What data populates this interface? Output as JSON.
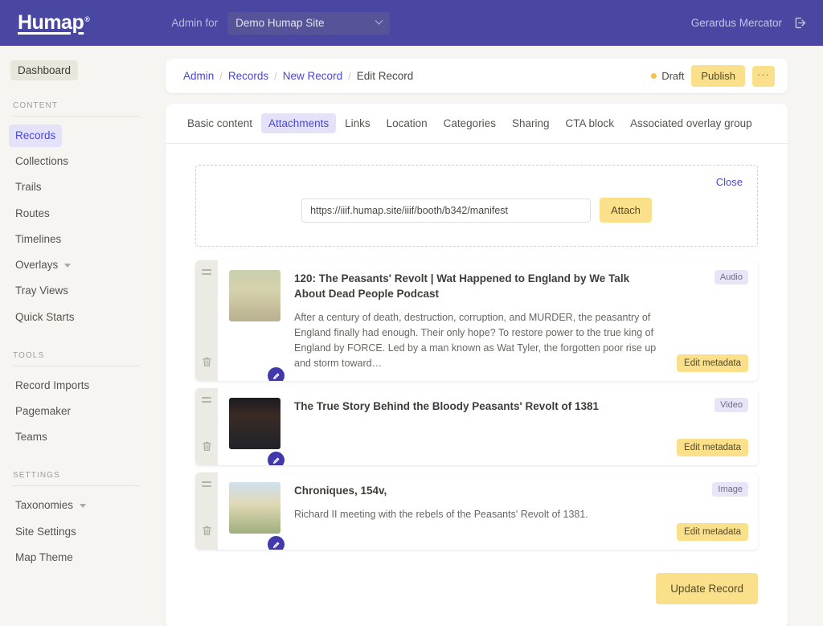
{
  "topbar": {
    "logo": "Humap",
    "logo_mark": "®",
    "admin_for_label": "Admin for",
    "site_name": "Demo Humap Site",
    "user_name": "Gerardus Mercator",
    "logout_icon": "logout-icon",
    "chevron_icon": "chevron-down-icon"
  },
  "sidebar": {
    "dashboard_label": "Dashboard",
    "groups": [
      {
        "label": "CONTENT",
        "items": [
          {
            "label": "Records",
            "active": true,
            "caret": false
          },
          {
            "label": "Collections",
            "active": false,
            "caret": false
          },
          {
            "label": "Trails",
            "active": false,
            "caret": false
          },
          {
            "label": "Routes",
            "active": false,
            "caret": false
          },
          {
            "label": "Timelines",
            "active": false,
            "caret": false
          },
          {
            "label": "Overlays",
            "active": false,
            "caret": true
          },
          {
            "label": "Tray Views",
            "active": false,
            "caret": false
          },
          {
            "label": "Quick Starts",
            "active": false,
            "caret": false
          }
        ]
      },
      {
        "label": "TOOLS",
        "items": [
          {
            "label": "Record Imports",
            "active": false,
            "caret": false
          },
          {
            "label": "Pagemaker",
            "active": false,
            "caret": false
          },
          {
            "label": "Teams",
            "active": false,
            "caret": false
          }
        ]
      },
      {
        "label": "SETTINGS",
        "items": [
          {
            "label": "Taxonomies",
            "active": false,
            "caret": true
          },
          {
            "label": "Site Settings",
            "active": false,
            "caret": false
          },
          {
            "label": "Map Theme",
            "active": false,
            "caret": false
          }
        ]
      }
    ]
  },
  "breadcrumb": {
    "items": [
      {
        "label": "Admin",
        "current": false
      },
      {
        "label": "Records",
        "current": false
      },
      {
        "label": "New Record",
        "current": false
      },
      {
        "label": "Edit Record",
        "current": true
      }
    ],
    "separator": "/",
    "status_label": "Draft",
    "status_color": "#f2c14e",
    "publish_label": "Publish",
    "more_label": "···"
  },
  "tabs": [
    {
      "label": "Basic content",
      "active": false
    },
    {
      "label": "Attachments",
      "active": true
    },
    {
      "label": "Links",
      "active": false
    },
    {
      "label": "Location",
      "active": false
    },
    {
      "label": "Categories",
      "active": false
    },
    {
      "label": "Sharing",
      "active": false
    },
    {
      "label": "CTA block",
      "active": false
    },
    {
      "label": "Associated overlay group",
      "active": false
    }
  ],
  "dropzone": {
    "close_label": "Close",
    "url_value": "https://iiif.humap.site/iiif/booth/b342/manifest",
    "url_placeholder": "https://",
    "attach_label": "Attach"
  },
  "attachments": {
    "edit_metadata_label": "Edit metadata",
    "drag_icon": "drag-handle-icon",
    "delete_icon": "trash-icon",
    "edit_thumb_icon": "pencil-icon",
    "items": [
      {
        "title": "120: The Peasants' Revolt | Wat Happened to England by We Talk About Dead People Podcast",
        "description": "After a century of death, destruction, corruption, and MURDER, the peasantry of England finally had enough. Their only hope? To restore power to the true king of England by FORCE. Led by a man known as Wat Tyler, the forgotten poor rise up and storm toward…",
        "type": "Audio",
        "thumb": "medieval-battle-manuscript"
      },
      {
        "title": "The True Story Behind the Bloody Peasants' Revolt of 1381",
        "description": "",
        "type": "Video",
        "thumb": "video-thumbnail-peasant-uprising"
      },
      {
        "title": "Chroniques, 154v,",
        "description": "Richard II meeting with the rebels of the Peasants' Revolt of 1381.",
        "type": "Image",
        "thumb": "chroniques-illumination"
      }
    ]
  },
  "footer": {
    "update_label": "Update Record"
  },
  "colors": {
    "brand_purple": "#4a47a3",
    "accent_yellow": "#fae08b",
    "link_indigo": "#4a47d6",
    "page_bg": "#f6f5f1"
  }
}
